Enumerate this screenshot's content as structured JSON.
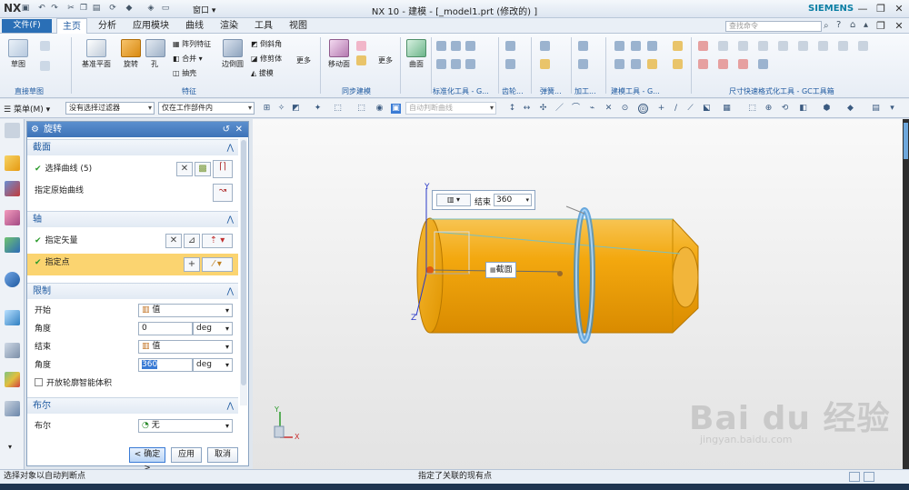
{
  "titlebar": {
    "logo": "NX",
    "title": "NX 10 - 建模 - [_model1.prt  (修改的) ]",
    "brand": "SIEMENS",
    "window_label": "窗口"
  },
  "menubar": {
    "file": "文件(F)",
    "tabs": [
      "主页",
      "分析",
      "应用模块",
      "曲线",
      "渲染",
      "工具",
      "视图"
    ],
    "search_placeholder": "查找命令"
  },
  "ribbon": {
    "buttons": [
      "草图",
      "基准平面",
      "旋转",
      "孔",
      "阵列特征",
      "合并",
      "抽壳",
      "边倒圆",
      "倒斜角",
      "修剪体",
      "拔模",
      "更多",
      "移动面",
      "更多",
      "曲面"
    ],
    "groups": [
      "直接草图",
      "特征",
      "同步建模",
      "标准化工具 - G...",
      "齿轮...",
      "弹簧...",
      "加工...",
      "建模工具 - G...",
      "尺寸快速格式化工具 - GC工具箱"
    ]
  },
  "toolbar2": {
    "menu": "菜单(M)",
    "filter": "没有选择过滤器",
    "scope": "仅在工作部件内",
    "snap": "自动判断曲线"
  },
  "dialog": {
    "title": "旋转",
    "section_label": "截面",
    "select_curve": "选择曲线 (5)",
    "specify_origin_curve": "指定原始曲线",
    "axis_label": "轴",
    "specify_vector": "指定矢量",
    "specify_point": "指定点",
    "limits_label": "限制",
    "start": "开始",
    "start_type": "值",
    "angle": "角度",
    "start_angle": "0",
    "unit": "deg",
    "end": "结束",
    "end_type": "值",
    "end_angle": "360",
    "open_profile": "开放轮廓智能体积",
    "bool_label": "布尔",
    "bool_field": "布尔",
    "bool_value": "无",
    "ok": "< 确定 >",
    "apply": "应用",
    "cancel": "取消"
  },
  "viewport": {
    "end_label": "结束",
    "end_value": "360",
    "section_tag": "截面",
    "axis_y": "Y",
    "axis_x": "X",
    "axis_z": "Z",
    "watermark": "Bai du 经验",
    "watermark_url": "jingyan.baidu.com"
  },
  "statusbar": {
    "left": "选择对象以自动判断点",
    "center": "指定了关联的现有点"
  },
  "colors": {
    "accent": "#2a6fb6",
    "solid": "#f0a010",
    "highlight": "#fbd470"
  }
}
